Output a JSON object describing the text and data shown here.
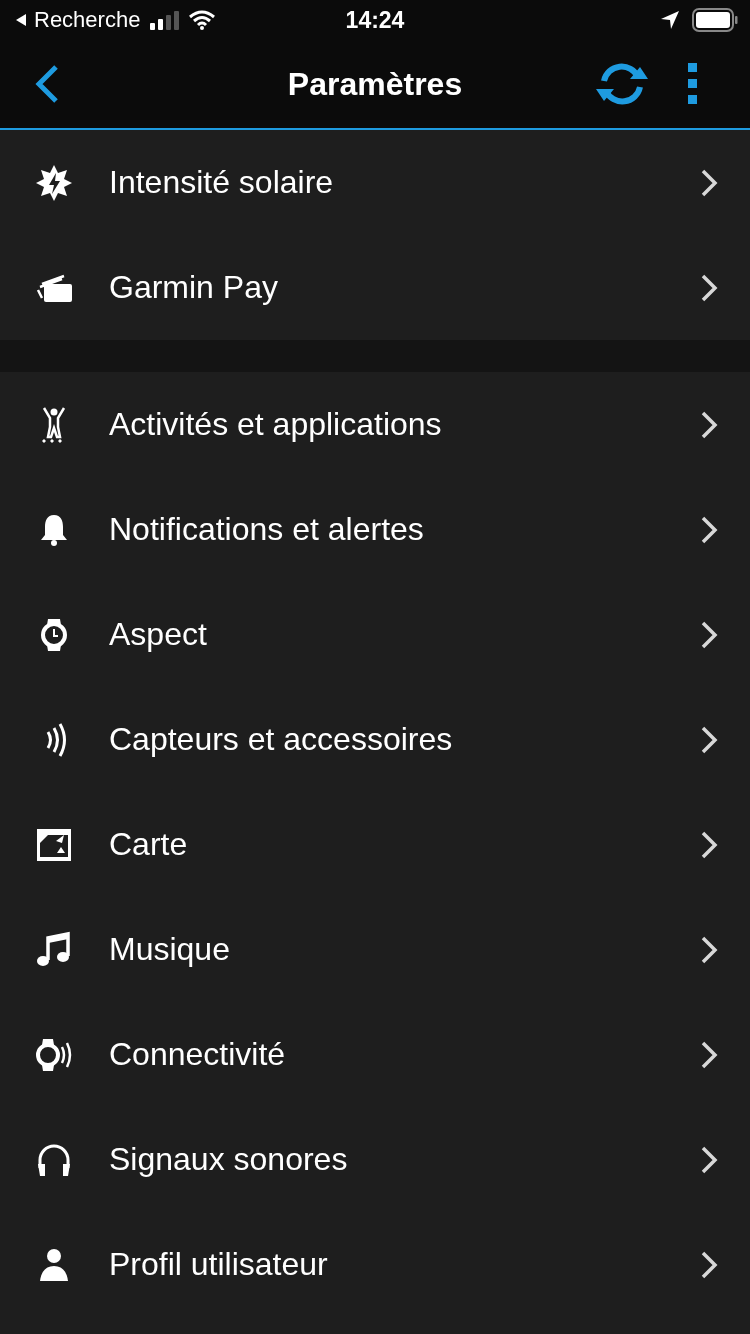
{
  "status_bar": {
    "back_app": "Recherche",
    "time": "14:24"
  },
  "header": {
    "title": "Paramètres"
  },
  "sections": [
    {
      "items": [
        {
          "label": "Intensité solaire"
        },
        {
          "label": "Garmin Pay"
        }
      ]
    },
    {
      "items": [
        {
          "label": "Activités et applications"
        },
        {
          "label": "Notifications et alertes"
        },
        {
          "label": "Aspect"
        },
        {
          "label": "Capteurs et accessoires"
        },
        {
          "label": "Carte"
        },
        {
          "label": "Musique"
        },
        {
          "label": "Connectivité"
        },
        {
          "label": "Signaux sonores"
        },
        {
          "label": "Profil utilisateur"
        }
      ]
    }
  ]
}
